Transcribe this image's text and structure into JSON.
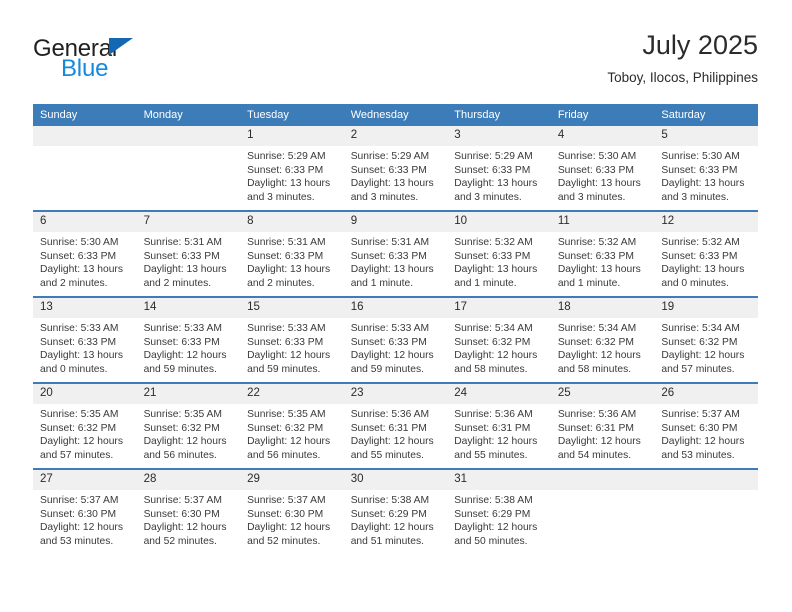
{
  "brand": {
    "name_top": "General",
    "name_bottom": "Blue",
    "accent_blue": "#1789dc",
    "triangle_blue": "#1268b3"
  },
  "header": {
    "title": "July 2025",
    "subtitle": "Toboy, Ilocos, Philippines"
  },
  "calendar": {
    "header_bg": "#3c7cb8",
    "daynum_bg": "#f0f0f0",
    "weekdays": [
      "Sunday",
      "Monday",
      "Tuesday",
      "Wednesday",
      "Thursday",
      "Friday",
      "Saturday"
    ],
    "weeks": [
      [
        {
          "day": "",
          "sunrise": "",
          "sunset": "",
          "daylight_1": "",
          "daylight_2": ""
        },
        {
          "day": "",
          "sunrise": "",
          "sunset": "",
          "daylight_1": "",
          "daylight_2": ""
        },
        {
          "day": "1",
          "sunrise": "Sunrise: 5:29 AM",
          "sunset": "Sunset: 6:33 PM",
          "daylight_1": "Daylight: 13 hours",
          "daylight_2": "and 3 minutes."
        },
        {
          "day": "2",
          "sunrise": "Sunrise: 5:29 AM",
          "sunset": "Sunset: 6:33 PM",
          "daylight_1": "Daylight: 13 hours",
          "daylight_2": "and 3 minutes."
        },
        {
          "day": "3",
          "sunrise": "Sunrise: 5:29 AM",
          "sunset": "Sunset: 6:33 PM",
          "daylight_1": "Daylight: 13 hours",
          "daylight_2": "and 3 minutes."
        },
        {
          "day": "4",
          "sunrise": "Sunrise: 5:30 AM",
          "sunset": "Sunset: 6:33 PM",
          "daylight_1": "Daylight: 13 hours",
          "daylight_2": "and 3 minutes."
        },
        {
          "day": "5",
          "sunrise": "Sunrise: 5:30 AM",
          "sunset": "Sunset: 6:33 PM",
          "daylight_1": "Daylight: 13 hours",
          "daylight_2": "and 3 minutes."
        }
      ],
      [
        {
          "day": "6",
          "sunrise": "Sunrise: 5:30 AM",
          "sunset": "Sunset: 6:33 PM",
          "daylight_1": "Daylight: 13 hours",
          "daylight_2": "and 2 minutes."
        },
        {
          "day": "7",
          "sunrise": "Sunrise: 5:31 AM",
          "sunset": "Sunset: 6:33 PM",
          "daylight_1": "Daylight: 13 hours",
          "daylight_2": "and 2 minutes."
        },
        {
          "day": "8",
          "sunrise": "Sunrise: 5:31 AM",
          "sunset": "Sunset: 6:33 PM",
          "daylight_1": "Daylight: 13 hours",
          "daylight_2": "and 2 minutes."
        },
        {
          "day": "9",
          "sunrise": "Sunrise: 5:31 AM",
          "sunset": "Sunset: 6:33 PM",
          "daylight_1": "Daylight: 13 hours",
          "daylight_2": "and 1 minute."
        },
        {
          "day": "10",
          "sunrise": "Sunrise: 5:32 AM",
          "sunset": "Sunset: 6:33 PM",
          "daylight_1": "Daylight: 13 hours",
          "daylight_2": "and 1 minute."
        },
        {
          "day": "11",
          "sunrise": "Sunrise: 5:32 AM",
          "sunset": "Sunset: 6:33 PM",
          "daylight_1": "Daylight: 13 hours",
          "daylight_2": "and 1 minute."
        },
        {
          "day": "12",
          "sunrise": "Sunrise: 5:32 AM",
          "sunset": "Sunset: 6:33 PM",
          "daylight_1": "Daylight: 13 hours",
          "daylight_2": "and 0 minutes."
        }
      ],
      [
        {
          "day": "13",
          "sunrise": "Sunrise: 5:33 AM",
          "sunset": "Sunset: 6:33 PM",
          "daylight_1": "Daylight: 13 hours",
          "daylight_2": "and 0 minutes."
        },
        {
          "day": "14",
          "sunrise": "Sunrise: 5:33 AM",
          "sunset": "Sunset: 6:33 PM",
          "daylight_1": "Daylight: 12 hours",
          "daylight_2": "and 59 minutes."
        },
        {
          "day": "15",
          "sunrise": "Sunrise: 5:33 AM",
          "sunset": "Sunset: 6:33 PM",
          "daylight_1": "Daylight: 12 hours",
          "daylight_2": "and 59 minutes."
        },
        {
          "day": "16",
          "sunrise": "Sunrise: 5:33 AM",
          "sunset": "Sunset: 6:33 PM",
          "daylight_1": "Daylight: 12 hours",
          "daylight_2": "and 59 minutes."
        },
        {
          "day": "17",
          "sunrise": "Sunrise: 5:34 AM",
          "sunset": "Sunset: 6:32 PM",
          "daylight_1": "Daylight: 12 hours",
          "daylight_2": "and 58 minutes."
        },
        {
          "day": "18",
          "sunrise": "Sunrise: 5:34 AM",
          "sunset": "Sunset: 6:32 PM",
          "daylight_1": "Daylight: 12 hours",
          "daylight_2": "and 58 minutes."
        },
        {
          "day": "19",
          "sunrise": "Sunrise: 5:34 AM",
          "sunset": "Sunset: 6:32 PM",
          "daylight_1": "Daylight: 12 hours",
          "daylight_2": "and 57 minutes."
        }
      ],
      [
        {
          "day": "20",
          "sunrise": "Sunrise: 5:35 AM",
          "sunset": "Sunset: 6:32 PM",
          "daylight_1": "Daylight: 12 hours",
          "daylight_2": "and 57 minutes."
        },
        {
          "day": "21",
          "sunrise": "Sunrise: 5:35 AM",
          "sunset": "Sunset: 6:32 PM",
          "daylight_1": "Daylight: 12 hours",
          "daylight_2": "and 56 minutes."
        },
        {
          "day": "22",
          "sunrise": "Sunrise: 5:35 AM",
          "sunset": "Sunset: 6:32 PM",
          "daylight_1": "Daylight: 12 hours",
          "daylight_2": "and 56 minutes."
        },
        {
          "day": "23",
          "sunrise": "Sunrise: 5:36 AM",
          "sunset": "Sunset: 6:31 PM",
          "daylight_1": "Daylight: 12 hours",
          "daylight_2": "and 55 minutes."
        },
        {
          "day": "24",
          "sunrise": "Sunrise: 5:36 AM",
          "sunset": "Sunset: 6:31 PM",
          "daylight_1": "Daylight: 12 hours",
          "daylight_2": "and 55 minutes."
        },
        {
          "day": "25",
          "sunrise": "Sunrise: 5:36 AM",
          "sunset": "Sunset: 6:31 PM",
          "daylight_1": "Daylight: 12 hours",
          "daylight_2": "and 54 minutes."
        },
        {
          "day": "26",
          "sunrise": "Sunrise: 5:37 AM",
          "sunset": "Sunset: 6:30 PM",
          "daylight_1": "Daylight: 12 hours",
          "daylight_2": "and 53 minutes."
        }
      ],
      [
        {
          "day": "27",
          "sunrise": "Sunrise: 5:37 AM",
          "sunset": "Sunset: 6:30 PM",
          "daylight_1": "Daylight: 12 hours",
          "daylight_2": "and 53 minutes."
        },
        {
          "day": "28",
          "sunrise": "Sunrise: 5:37 AM",
          "sunset": "Sunset: 6:30 PM",
          "daylight_1": "Daylight: 12 hours",
          "daylight_2": "and 52 minutes."
        },
        {
          "day": "29",
          "sunrise": "Sunrise: 5:37 AM",
          "sunset": "Sunset: 6:30 PM",
          "daylight_1": "Daylight: 12 hours",
          "daylight_2": "and 52 minutes."
        },
        {
          "day": "30",
          "sunrise": "Sunrise: 5:38 AM",
          "sunset": "Sunset: 6:29 PM",
          "daylight_1": "Daylight: 12 hours",
          "daylight_2": "and 51 minutes."
        },
        {
          "day": "31",
          "sunrise": "Sunrise: 5:38 AM",
          "sunset": "Sunset: 6:29 PM",
          "daylight_1": "Daylight: 12 hours",
          "daylight_2": "and 50 minutes."
        },
        {
          "day": "",
          "sunrise": "",
          "sunset": "",
          "daylight_1": "",
          "daylight_2": ""
        },
        {
          "day": "",
          "sunrise": "",
          "sunset": "",
          "daylight_1": "",
          "daylight_2": ""
        }
      ]
    ]
  }
}
